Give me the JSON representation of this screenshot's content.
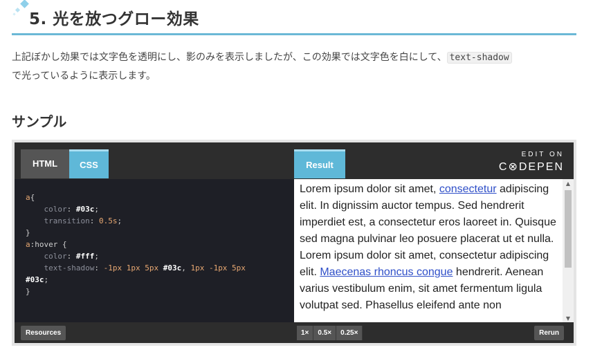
{
  "section": {
    "title": "5. 光を放つグロー効果",
    "desc_part1": "上記ぼかし効果では文字色を透明にし、影のみを表示しましたが、この効果では文字色を白にして、",
    "desc_code": "text-shadow",
    "desc_part2": "で光っているように表示します。",
    "sample_heading": "サンプル"
  },
  "codepen": {
    "tabs": {
      "html": "HTML",
      "css": "CSS",
      "result": "Result"
    },
    "logo": {
      "edit_on": "EDIT ON",
      "name": "C⊗DEPEN"
    },
    "code": {
      "l1_sel": "a",
      "l1_brace": "{",
      "l2_prop": "    color",
      "l2_val": "#03c",
      "l3_prop": "    transition",
      "l3_val": "0.5s",
      "l4": "}",
      "l5_sel": "a",
      "l5_rest": ":hover {",
      "l6_prop": "    color",
      "l6_val": "#fff",
      "l7_prop": "    text-shadow",
      "l7_a": "-1px 1px 5px",
      "l7_b": "#03c",
      "l7_c": "1px -1px 5px",
      "l8": "#03c",
      "l9": "}"
    },
    "result": {
      "t1": "Lorem ipsum dolor sit amet, ",
      "link1": "consectetur",
      "t2": " adipiscing elit. In dignissim auctor tempus. Sed hendrerit imperdiet est, a consectetur eros laoreet in. Quisque sed magna pulvinar leo posuere placerat ut et nulla. Lorem ipsum dolor sit amet, consectetur adipiscing elit. ",
      "link2": "Maecenas rhoncus congue",
      "t3": " hendrerit. Aenean varius vestibulum enim, sit amet fermentum ligula volutpat sed. Phasellus eleifend ante non"
    },
    "buttons": {
      "resources": "Resources",
      "zoom_1": "1×",
      "zoom_05": "0.5×",
      "zoom_025": "0.25×",
      "rerun": "Rerun"
    },
    "colors": {
      "accent": "#5fb8d8",
      "link": "#2f4fc8",
      "rule": "#6bb8d6"
    }
  }
}
